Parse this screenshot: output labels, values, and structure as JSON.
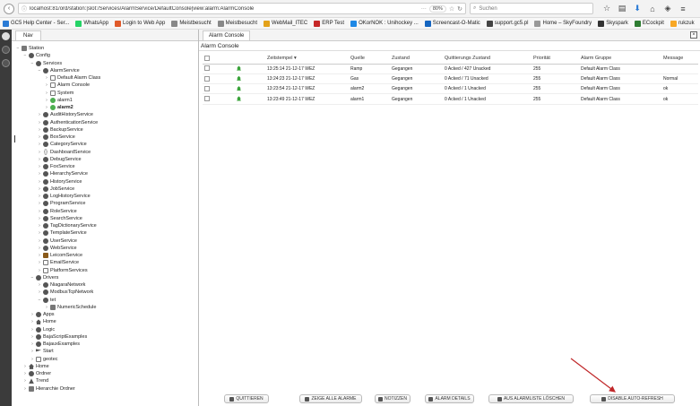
{
  "browser": {
    "url": "localhost:81/ord/station:|slot:/Services/AlarmService/DefaultConsole|view:alarm:AlarmConsole",
    "zoom": "80%",
    "search_placeholder": "Suchen",
    "bookmarks": [
      {
        "label": "GC5 Help Center - Ser...",
        "color": "#2b7bd5"
      },
      {
        "label": "WhatsApp",
        "color": "#25d366"
      },
      {
        "label": "Login to Web App",
        "color": "#e05a2a"
      },
      {
        "label": "Meistbesucht",
        "color": "#888888"
      },
      {
        "label": "Meistbesucht",
        "color": "#888888"
      },
      {
        "label": "WebMail_ITEC",
        "color": "#e3a21a"
      },
      {
        "label": "ERP Test",
        "color": "#c62828"
      },
      {
        "label": "OKorNOK : Unihockey ...",
        "color": "#1e88e5"
      },
      {
        "label": "Screencast-O-Matic",
        "color": "#1565c0"
      },
      {
        "label": "support.gc5.pl",
        "color": "#444444"
      },
      {
        "label": "Home – SkyFoundry",
        "color": "#999999"
      },
      {
        "label": "Skyspark",
        "color": "#333333"
      },
      {
        "label": "ECockpit",
        "color": "#2e7d32"
      },
      {
        "label": "rukzuk",
        "color": "#f9a825"
      }
    ]
  },
  "nav": {
    "tab_label": "Nav",
    "tree": [
      {
        "label": "Station",
        "level": 0,
        "tog": "−",
        "icon": "sq"
      },
      {
        "label": "Config",
        "level": 1,
        "tog": "−",
        "icon": "circle"
      },
      {
        "label": "Services",
        "level": 2,
        "tog": "−",
        "icon": "circle"
      },
      {
        "label": "AlarmService",
        "level": 3,
        "tog": "−",
        "icon": "circle"
      },
      {
        "label": "Default Alarm Class",
        "level": 4,
        "tog": "›",
        "icon": "folder"
      },
      {
        "label": "Alarm Console",
        "level": 4,
        "tog": "›",
        "icon": "folder"
      },
      {
        "label": "System",
        "level": 4,
        "tog": "›",
        "icon": "folder"
      },
      {
        "label": "alarm1",
        "level": 4,
        "tog": "›",
        "icon": "alarm"
      },
      {
        "label": "alarm2",
        "level": 4,
        "tog": "›",
        "icon": "alarm",
        "selected": true
      },
      {
        "label": "AuditHistoryService",
        "level": 3,
        "tog": "›",
        "icon": "circle"
      },
      {
        "label": "AuthenticationService",
        "level": 3,
        "tog": "›",
        "icon": "circle"
      },
      {
        "label": "BackupService",
        "level": 3,
        "tog": "›",
        "icon": "circle"
      },
      {
        "label": "BoxService",
        "level": 3,
        "tog": "›",
        "icon": "circle"
      },
      {
        "label": "CategoryService",
        "level": 3,
        "tog": "›",
        "icon": "circle"
      },
      {
        "label": "DashboardService",
        "level": 3,
        "tog": "›",
        "icon": "brace"
      },
      {
        "label": "DebugService",
        "level": 3,
        "tog": "›",
        "icon": "circle"
      },
      {
        "label": "FoxService",
        "level": 3,
        "tog": "›",
        "icon": "circle"
      },
      {
        "label": "HierarchyService",
        "level": 3,
        "tog": "›",
        "icon": "circle"
      },
      {
        "label": "HistoryService",
        "level": 3,
        "tog": "›",
        "icon": "circle"
      },
      {
        "label": "JobService",
        "level": 3,
        "tog": "›",
        "icon": "circle"
      },
      {
        "label": "LogHistoryService",
        "level": 3,
        "tog": "›",
        "icon": "circle"
      },
      {
        "label": "ProgramService",
        "level": 3,
        "tog": "›",
        "icon": "circle"
      },
      {
        "label": "RoleService",
        "level": 3,
        "tog": "›",
        "icon": "circle"
      },
      {
        "label": "SearchService",
        "level": 3,
        "tog": "›",
        "icon": "circle"
      },
      {
        "label": "TagDictionaryService",
        "level": 3,
        "tog": "›",
        "icon": "circle"
      },
      {
        "label": "TemplateService",
        "level": 3,
        "tog": "›",
        "icon": "circle"
      },
      {
        "label": "UserService",
        "level": 3,
        "tog": "›",
        "icon": "circle"
      },
      {
        "label": "WebService",
        "level": 3,
        "tog": "›",
        "icon": "circle"
      },
      {
        "label": "LeicomService",
        "level": 3,
        "tog": "›",
        "icon": "orange"
      },
      {
        "label": "EmailService",
        "level": 3,
        "tog": "›",
        "icon": "folder"
      },
      {
        "label": "PlatformServices",
        "level": 3,
        "tog": "›",
        "icon": "folder"
      },
      {
        "label": "Drivers",
        "level": 2,
        "tog": "−",
        "icon": "circle"
      },
      {
        "label": "NiagaraNetwork",
        "level": 3,
        "tog": "›",
        "icon": "circle"
      },
      {
        "label": "ModbusTcpNetwork",
        "level": 3,
        "tog": "›",
        "icon": "circle"
      },
      {
        "label": "tet",
        "level": 3,
        "tog": "−",
        "icon": "circle"
      },
      {
        "label": "NumericSchedule",
        "level": 4,
        "tog": "›",
        "icon": "sq"
      },
      {
        "label": "Apps",
        "level": 2,
        "tog": "›",
        "icon": "circle"
      },
      {
        "label": "Home",
        "level": 2,
        "tog": "›",
        "icon": "home"
      },
      {
        "label": "Logic",
        "level": 2,
        "tog": "›",
        "icon": "circle"
      },
      {
        "label": "BajaScriptExamples",
        "level": 2,
        "tog": "›",
        "icon": "circle"
      },
      {
        "label": "BajauxExamples",
        "level": 2,
        "tog": "›",
        "icon": "circle"
      },
      {
        "label": "Start",
        "level": 2,
        "tog": "›",
        "icon": "flag"
      },
      {
        "label": "geotec",
        "level": 2,
        "tog": "›",
        "icon": "folder"
      },
      {
        "label": "Home",
        "level": 1,
        "tog": "›",
        "icon": "home"
      },
      {
        "label": "Ordner",
        "level": 1,
        "tog": "›",
        "icon": "circle"
      },
      {
        "label": "Trend",
        "level": 1,
        "tog": "›",
        "icon": "tri"
      },
      {
        "label": "Hierarchie Ordner",
        "level": 1,
        "tog": "›",
        "icon": "sq"
      }
    ]
  },
  "main": {
    "tab_label": "Alarm Console",
    "panel_title": "Alarm Console",
    "columns": [
      "Zeitstempel ▾",
      "Quelle",
      "Zustand",
      "Quittierungs Zustand",
      "Priorität",
      "Alarm Gruppe",
      "Message"
    ],
    "rows": [
      {
        "time": "13:25:14 21-12-17 WEZ",
        "source": "Ramp",
        "state": "Gegangen",
        "ack": "0 Acked / 427 Unacked",
        "priority": "255",
        "group": "Default Alarm Class",
        "message": ""
      },
      {
        "time": "13:24:23 21-12-17 WEZ",
        "source": "Gas",
        "state": "Gegangen",
        "ack": "0 Acked / 71 Unacked",
        "priority": "255",
        "group": "Default Alarm Class",
        "message": "Normal"
      },
      {
        "time": "13:23:54 21-12-17 WEZ",
        "source": "alarm2",
        "state": "Gegangen",
        "ack": "0 Acked / 1 Unacked",
        "priority": "255",
        "group": "Default Alarm Class",
        "message": "ok"
      },
      {
        "time": "13:23:49 21-12-17 WEZ",
        "source": "alarm1",
        "state": "Gegangen",
        "ack": "0 Acked / 1 Unacked",
        "priority": "255",
        "group": "Default Alarm Class",
        "message": "ok"
      }
    ],
    "buttons": [
      {
        "label": "QUITTIEREN",
        "icon": "ack-icon"
      },
      {
        "label": "ZEIGE ALLE ALARME",
        "icon": "filter-icon"
      },
      {
        "label": "NOTIZZEN",
        "icon": "notes-icon"
      },
      {
        "label": "ALARM DETAILS",
        "icon": "details-icon"
      },
      {
        "label": "AUS ALARMLISTE LÖSCHEN",
        "icon": "remove-icon"
      },
      {
        "label": "DISABLE AUTO-REFRESH",
        "icon": "refresh-icon"
      }
    ]
  },
  "annotation_color": "#c0282a"
}
